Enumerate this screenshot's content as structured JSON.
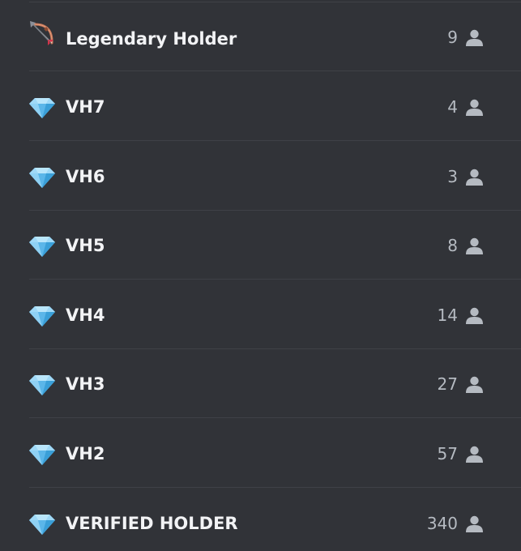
{
  "roles": [
    {
      "name": "Legendary Holder",
      "count": "9",
      "icon": "bow-and-arrow-icon"
    },
    {
      "name": "VH7",
      "count": "4",
      "icon": "gem-stone-icon"
    },
    {
      "name": "VH6",
      "count": "3",
      "icon": "gem-stone-icon"
    },
    {
      "name": "VH5",
      "count": "8",
      "icon": "gem-stone-icon"
    },
    {
      "name": "VH4",
      "count": "14",
      "icon": "gem-stone-icon"
    },
    {
      "name": "VH3",
      "count": "27",
      "icon": "gem-stone-icon"
    },
    {
      "name": "VH2",
      "count": "57",
      "icon": "gem-stone-icon"
    },
    {
      "name": "VERIFIED HOLDER",
      "count": "340",
      "icon": "gem-stone-icon"
    }
  ],
  "member_icon": "member-person-icon",
  "colors": {
    "background": "#313338",
    "divider": "#3f4147",
    "role_text": "#f2f3f5",
    "count_text": "#b5bac1",
    "gem_light": "#b9e6fb",
    "gem_mid": "#6fc4f0",
    "gem_dark": "#3a9fd8",
    "bow_wood": "#c4775a"
  }
}
